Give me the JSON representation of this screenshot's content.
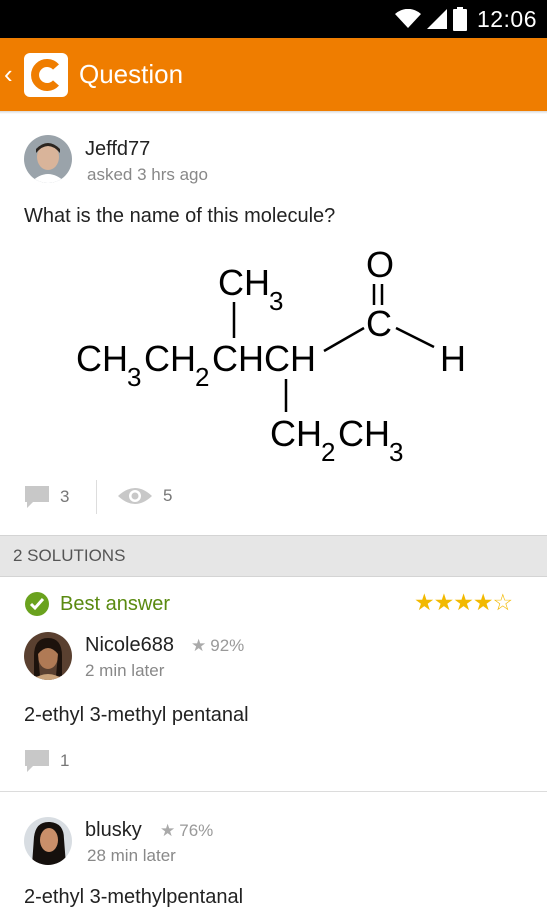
{
  "status_bar": {
    "time": "12:06"
  },
  "app_bar": {
    "title": "Question"
  },
  "question": {
    "author": "Jeffd77",
    "meta": "asked 3 hrs ago",
    "text": "What is the name of this molecule?",
    "comments": "3",
    "views": "5"
  },
  "solutions_header": "2 SOLUTIONS",
  "answers": [
    {
      "best_label": "Best answer",
      "rating_stars": 4,
      "rating_max": 5,
      "author": "Nicole688",
      "score": "92%",
      "meta": "2 min later",
      "text": "2-ethyl 3-methyl pentanal",
      "comments": "1"
    },
    {
      "author": "blusky",
      "score": "76%",
      "meta": "28 min later",
      "text": "2-ethyl 3-methylpentanal"
    }
  ]
}
